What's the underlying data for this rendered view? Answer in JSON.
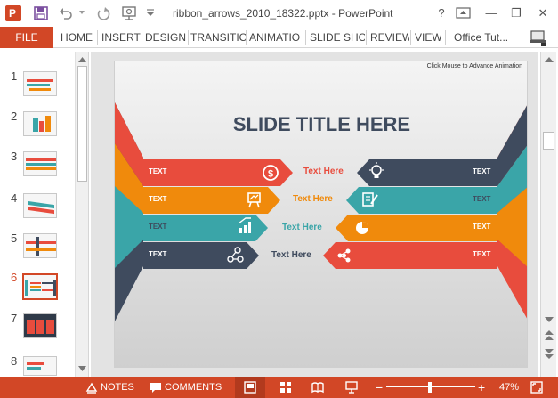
{
  "app": {
    "logo_letter": "P",
    "title": "ribbon_arrows_2010_18322.pptx - PowerPoint",
    "help": "?",
    "minimize": "—",
    "restore": "❐",
    "close": "✕"
  },
  "ribbon": {
    "file": "FILE",
    "tabs": [
      "HOME",
      "INSERT",
      "DESIGN",
      "TRANSITIO",
      "ANIMATIO",
      "SLIDE SHO",
      "REVIEW",
      "VIEW",
      "Office Tut..."
    ]
  },
  "thumbnails": [
    {
      "number": "1"
    },
    {
      "number": "2"
    },
    {
      "number": "3"
    },
    {
      "number": "4"
    },
    {
      "number": "5"
    },
    {
      "number": "6"
    },
    {
      "number": "7"
    },
    {
      "number": "8"
    }
  ],
  "active_slide": "6",
  "slide": {
    "hint": "Click Mouse to Advance Animation",
    "title": "SLIDE TITLE HERE",
    "left_rows": [
      {
        "label": "TEXT",
        "center_text": "Text Here",
        "color": "#e84c3d",
        "icon": "dollar-coin-icon"
      },
      {
        "label": "TEXT",
        "center_text": "Text Here",
        "color": "#f08a0c",
        "icon": "presentation-board-icon"
      },
      {
        "label": "TEXT",
        "center_text": "Text Here",
        "color": "#3aa5a8",
        "icon": "growth-chart-icon"
      },
      {
        "label": "TEXT",
        "center_text": "Text Here",
        "color": "#3f4b5e",
        "icon": "network-nodes-icon"
      }
    ],
    "right_rows": [
      {
        "label": "TEXT",
        "color": "#3f4b5e",
        "icon": "lightbulb-icon"
      },
      {
        "label": "TEXT",
        "color": "#3aa5a8",
        "icon": "edit-document-icon"
      },
      {
        "label": "TEXT",
        "color": "#f08a0c",
        "icon": "pie-chart-icon"
      },
      {
        "label": "TEXT",
        "color": "#e84c3d",
        "icon": "share-nodes-icon"
      }
    ],
    "title_color": "#3f4b5e"
  },
  "status": {
    "notes": "NOTES",
    "comments": "COMMENTS",
    "zoom_minus": "−",
    "zoom_plus": "+",
    "zoom": "47%",
    "zoom_level": 0.47
  },
  "colors": {
    "accent": "#d24726",
    "red": "#e84c3d",
    "orange": "#f08a0c",
    "teal": "#3aa5a8",
    "navy": "#3f4b5e"
  }
}
